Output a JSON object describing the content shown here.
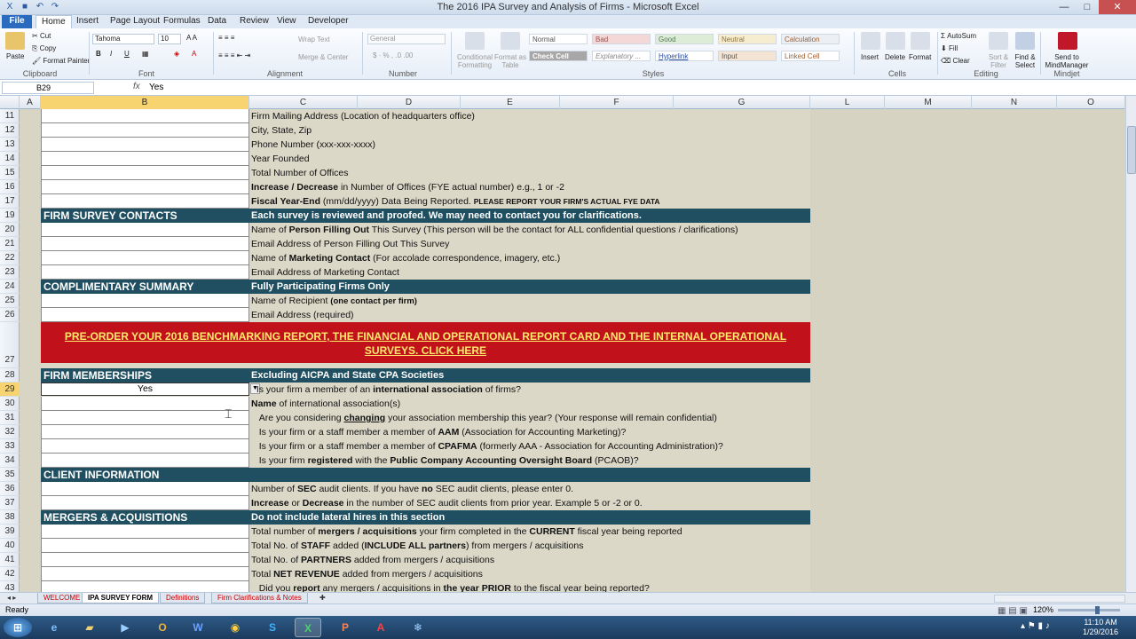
{
  "window": {
    "title": "The 2016 IPA Survey and Analysis of Firms  -  Microsoft Excel"
  },
  "ribbon_tabs": [
    "File",
    "Home",
    "Insert",
    "Page Layout",
    "Formulas",
    "Data",
    "Review",
    "View",
    "Developer"
  ],
  "ribbon": {
    "clipboard": {
      "paste": "Paste",
      "cut": "Cut",
      "copy": "Copy",
      "format_painter": "Format Painter",
      "label": "Clipboard"
    },
    "font": {
      "name": "Tahoma",
      "size": "10",
      "label": "Font"
    },
    "alignment": {
      "wrap": "Wrap Text",
      "merge": "Merge & Center",
      "label": "Alignment"
    },
    "number": {
      "format": "General",
      "label": "Number"
    },
    "styles": {
      "conditional": "Conditional Formatting",
      "as_table": "Format as Table",
      "label": "Styles",
      "cells": [
        "Normal",
        "Bad",
        "Good",
        "Neutral",
        "Calculation",
        "Check Cell",
        "Explanatory ...",
        "Hyperlink",
        "Input",
        "Linked Cell"
      ]
    },
    "cells": {
      "insert": "Insert",
      "delete": "Delete",
      "format": "Format",
      "label": "Cells"
    },
    "editing": {
      "autosum": "AutoSum",
      "fill": "Fill",
      "clear": "Clear",
      "sort": "Sort & Filter",
      "find": "Find & Select",
      "label": "Editing"
    },
    "mindjet": {
      "send": "Send to MindManager",
      "label": "Mindjet"
    }
  },
  "formula_bar": {
    "name_box": "B29",
    "fx": "fx",
    "value": "Yes"
  },
  "columns": [
    "A",
    "B",
    "C",
    "D",
    "E",
    "F",
    "G",
    "L",
    "M",
    "N",
    "O"
  ],
  "rows": [
    {
      "n": "11",
      "type": "item",
      "text": "Firm Mailing Address (Location of headquarters office)"
    },
    {
      "n": "12",
      "type": "item",
      "text": "City, State, Zip"
    },
    {
      "n": "13",
      "type": "item",
      "text": "Phone Number (xxx-xxx-xxxx)"
    },
    {
      "n": "14",
      "type": "item",
      "text": "Year Founded"
    },
    {
      "n": "15",
      "type": "item",
      "text": "Total Number of Offices"
    },
    {
      "n": "16",
      "type": "item",
      "html": "<b>Increase / Decrease</b> in Number of Offices (FYE actual number) e.g., 1 or -2"
    },
    {
      "n": "17",
      "type": "item",
      "html": "<b>Fiscal Year-End</b> (mm/dd/yyyy) Data Being Reported.  <b style='font-size:8.5px'>PLEASE REPORT YOUR FIRM'S ACTUAL FYE DATA</b>"
    },
    {
      "n": "19",
      "type": "section",
      "left": "FIRM SURVEY CONTACTS",
      "right": "Each survey is reviewed and proofed. We may need to contact you for clarifications."
    },
    {
      "n": "20",
      "type": "item",
      "html": "Name of <b>Person Filling Out</b> This Survey (This person will be the contact for ALL confidential questions / clarifications)"
    },
    {
      "n": "21",
      "type": "item",
      "text": "Email Address of Person Filling Out This Survey"
    },
    {
      "n": "22",
      "type": "item",
      "html": "Name of <b>Marketing Contact</b> (For accolade correspondence, imagery, etc.)"
    },
    {
      "n": "23",
      "type": "item",
      "text": "Email Address of Marketing Contact"
    },
    {
      "n": "24",
      "type": "section",
      "left": "COMPLIMENTARY SUMMARY",
      "right": "Fully Participating Firms Only"
    },
    {
      "n": "25",
      "type": "item",
      "html": "Name of Recipient <b style='font-size:9.5px'>(one contact per firm)</b>"
    },
    {
      "n": "26",
      "type": "item",
      "text": "Email Address (required)"
    },
    {
      "n": "27",
      "type": "banner",
      "text": "PRE-ORDER YOUR 2016 BENCHMARKING REPORT, THE FINANCIAL AND OPERATIONAL REPORT CARD AND THE INTERNAL OPERATIONAL SURVEYS. CLICK HERE"
    },
    {
      "n": "28",
      "type": "section",
      "left": "FIRM MEMBERSHIPS",
      "right": "Excluding AICPA and State CPA Societies"
    },
    {
      "n": "29",
      "type": "yes",
      "value": "Yes",
      "html": "&nbsp;&nbsp;Is your firm a member of an <b>international association</b> of firms?"
    },
    {
      "n": "30",
      "type": "item",
      "html": "<b>Name</b> of international association(s)"
    },
    {
      "n": "31",
      "type": "item",
      "html": "&nbsp;&nbsp;&nbsp;Are you considering <b><u>changing</u></b> your association membership this year? (Your response will remain confidential)"
    },
    {
      "n": "32",
      "type": "item",
      "html": "&nbsp;&nbsp;&nbsp;Is your firm or a staff member a member of <b>AAM</b> (Association for Accounting Marketing)?"
    },
    {
      "n": "33",
      "type": "item",
      "html": "&nbsp;&nbsp;&nbsp;Is your firm or a staff member a member of <b>CPAFMA</b> (formerly AAA - Association for Accounting Administration)?"
    },
    {
      "n": "34",
      "type": "item",
      "html": "&nbsp;&nbsp;&nbsp;Is your firm <b>registered</b> with the <b>Public Company Accounting Oversight Board</b> (PCAOB)?"
    },
    {
      "n": "35",
      "type": "section",
      "left": "CLIENT INFORMATION",
      "right": ""
    },
    {
      "n": "36",
      "type": "item",
      "html": "Number of <b>SEC</b> audit clients. If you have <b>no</b> SEC audit clients, please enter 0."
    },
    {
      "n": "37",
      "type": "item",
      "html": "<b>Increase</b> or <b>Decrease</b> in the number of SEC audit clients from prior year. Example 5 or -2  or 0."
    },
    {
      "n": "38",
      "type": "section",
      "left": "MERGERS & ACQUISITIONS",
      "right": " Do not include lateral hires in this section"
    },
    {
      "n": "39",
      "type": "item",
      "html": "Total number of <b>mergers / acquisitions</b> your firm completed in the <b>CURRENT</b> fiscal year being reported"
    },
    {
      "n": "40",
      "type": "item",
      "html": "Total No. of <b>STAFF</b> added (<b>INCLUDE ALL partners</b>) from mergers / acquisitions"
    },
    {
      "n": "41",
      "type": "item",
      "html": "Total No. of <b>PARTNERS</b> added from mergers / acquisitions"
    },
    {
      "n": "42",
      "type": "item",
      "html": "Total <b>NET REVENUE</b> added from mergers / acquisitions"
    },
    {
      "n": "43",
      "type": "item",
      "html": "&nbsp;&nbsp;&nbsp;Did you <b>report</b> any mergers / acquisitions in <b>the year PRIOR</b> to the fiscal year being reported?"
    }
  ],
  "sheet_tabs": [
    "WELCOME",
    "IPA SURVEY FORM",
    "Definitions",
    "Firm Clarifications & Notes"
  ],
  "status": {
    "ready": "Ready",
    "zoom": "120%"
  },
  "taskbar": {
    "time": "11:10 AM",
    "date": "1/29/2016"
  }
}
